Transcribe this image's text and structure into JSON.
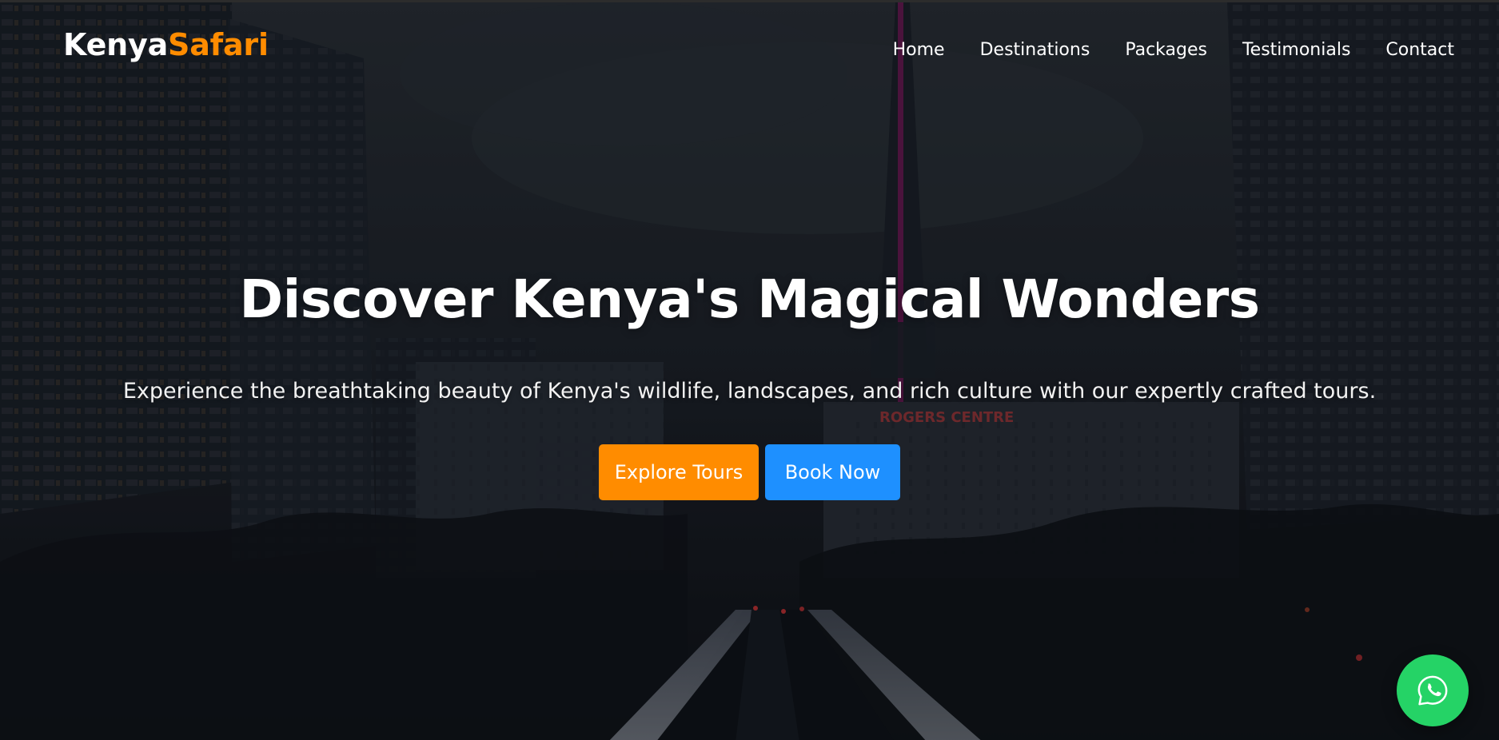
{
  "brand": {
    "name_part1": "Kenya",
    "name_part2": "Safari",
    "accent_color": "#ff8c00"
  },
  "nav": {
    "items": [
      {
        "label": "Home"
      },
      {
        "label": "Destinations"
      },
      {
        "label": "Packages"
      },
      {
        "label": "Testimonials"
      },
      {
        "label": "Contact"
      }
    ]
  },
  "hero": {
    "headline": "Discover Kenya's Magical Wonders",
    "subtext": "Experience the breathtaking beauty of Kenya's wildlife, landscapes, and rich culture with our expertly crafted tours.",
    "buttons": [
      {
        "label": "Explore Tours",
        "color": "#ff8c00"
      },
      {
        "label": "Book Now",
        "color": "#1e90ff"
      }
    ],
    "background_sign": "ROGERS CENTRE"
  },
  "floating": {
    "whatsapp_icon": "whatsapp-icon",
    "whatsapp_color": "#25d366"
  }
}
